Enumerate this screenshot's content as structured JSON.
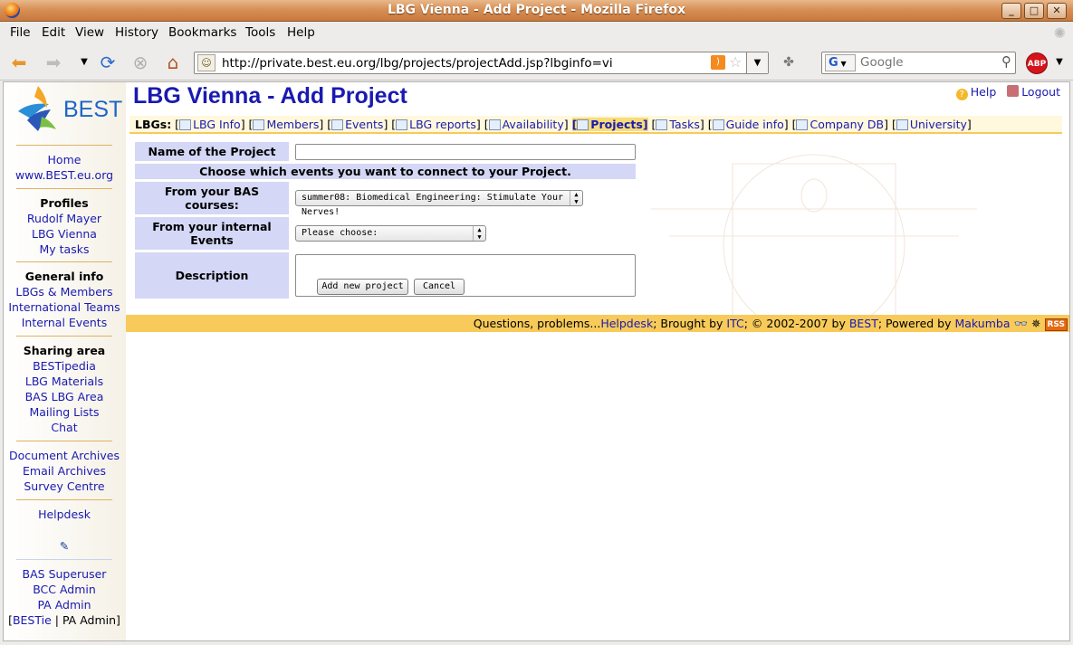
{
  "window": {
    "title": "LBG Vienna - Add Project - Mozilla Firefox"
  },
  "menu": [
    "File",
    "Edit",
    "View",
    "History",
    "Bookmarks",
    "Tools",
    "Help"
  ],
  "nav": {
    "url": "http://private.best.eu.org/lbg/projects/projectAdd.jsp?lbginfo=vi",
    "search_placeholder": "Google",
    "search_engine": "G",
    "abp": "ABP"
  },
  "logo": {
    "text": "BEST"
  },
  "sidebar": {
    "links1": [
      "Home",
      "www.BEST.eu.org"
    ],
    "profiles_head": "Profiles",
    "profiles": [
      "Rudolf Mayer",
      "LBG Vienna",
      "My tasks"
    ],
    "general_head": "General info",
    "general": [
      "LBGs & Members",
      "International Teams",
      "Internal Events"
    ],
    "sharing_head": "Sharing area",
    "sharing": [
      "BESTipedia",
      "LBG Materials",
      "BAS LBG Area",
      "Mailing Lists",
      "Chat"
    ],
    "archives": [
      "Document Archives",
      "Email Archives",
      "Survey Centre"
    ],
    "helpdesk": "Helpdesk",
    "admin": [
      "BAS Superuser",
      "BCC Admin",
      "PA Admin"
    ],
    "bestie_open": "[",
    "bestie": "BESTie",
    "pa_admin_tail": " | PA Admin]"
  },
  "page": {
    "title": "LBG Vienna - Add Project",
    "help": "Help",
    "logout": "Logout",
    "lbgs_label": "LBGs:",
    "tabs": [
      "LBG Info",
      "Members",
      "Events",
      "LBG reports",
      "Availability",
      "Projects",
      "Tasks",
      "Guide info",
      "Company DB",
      "University"
    ],
    "active_tab": "Projects"
  },
  "form": {
    "name_label": "Name of the Project",
    "name_value": "",
    "choose_band": "Choose which events you want to connect to your Project.",
    "bas_label": "From your BAS courses:",
    "bas_value": "summer08: Biomedical Engineering: Stimulate Your Nerves!",
    "internal_label": "From your internal Events",
    "internal_value": "Please choose:",
    "desc_label": "Description",
    "desc_value": "",
    "add_button": "Add new project",
    "cancel_button": "Cancel"
  },
  "footer": {
    "questions": "Questions, problems...",
    "helpdesk": "Helpdesk",
    "brought": "; Brought by ",
    "itc": "ITC",
    "copy": "; © 2002-2007 by ",
    "best": "BEST",
    "powered": "; Powered by ",
    "makumba": "Makumba",
    "rss": "RSS"
  }
}
